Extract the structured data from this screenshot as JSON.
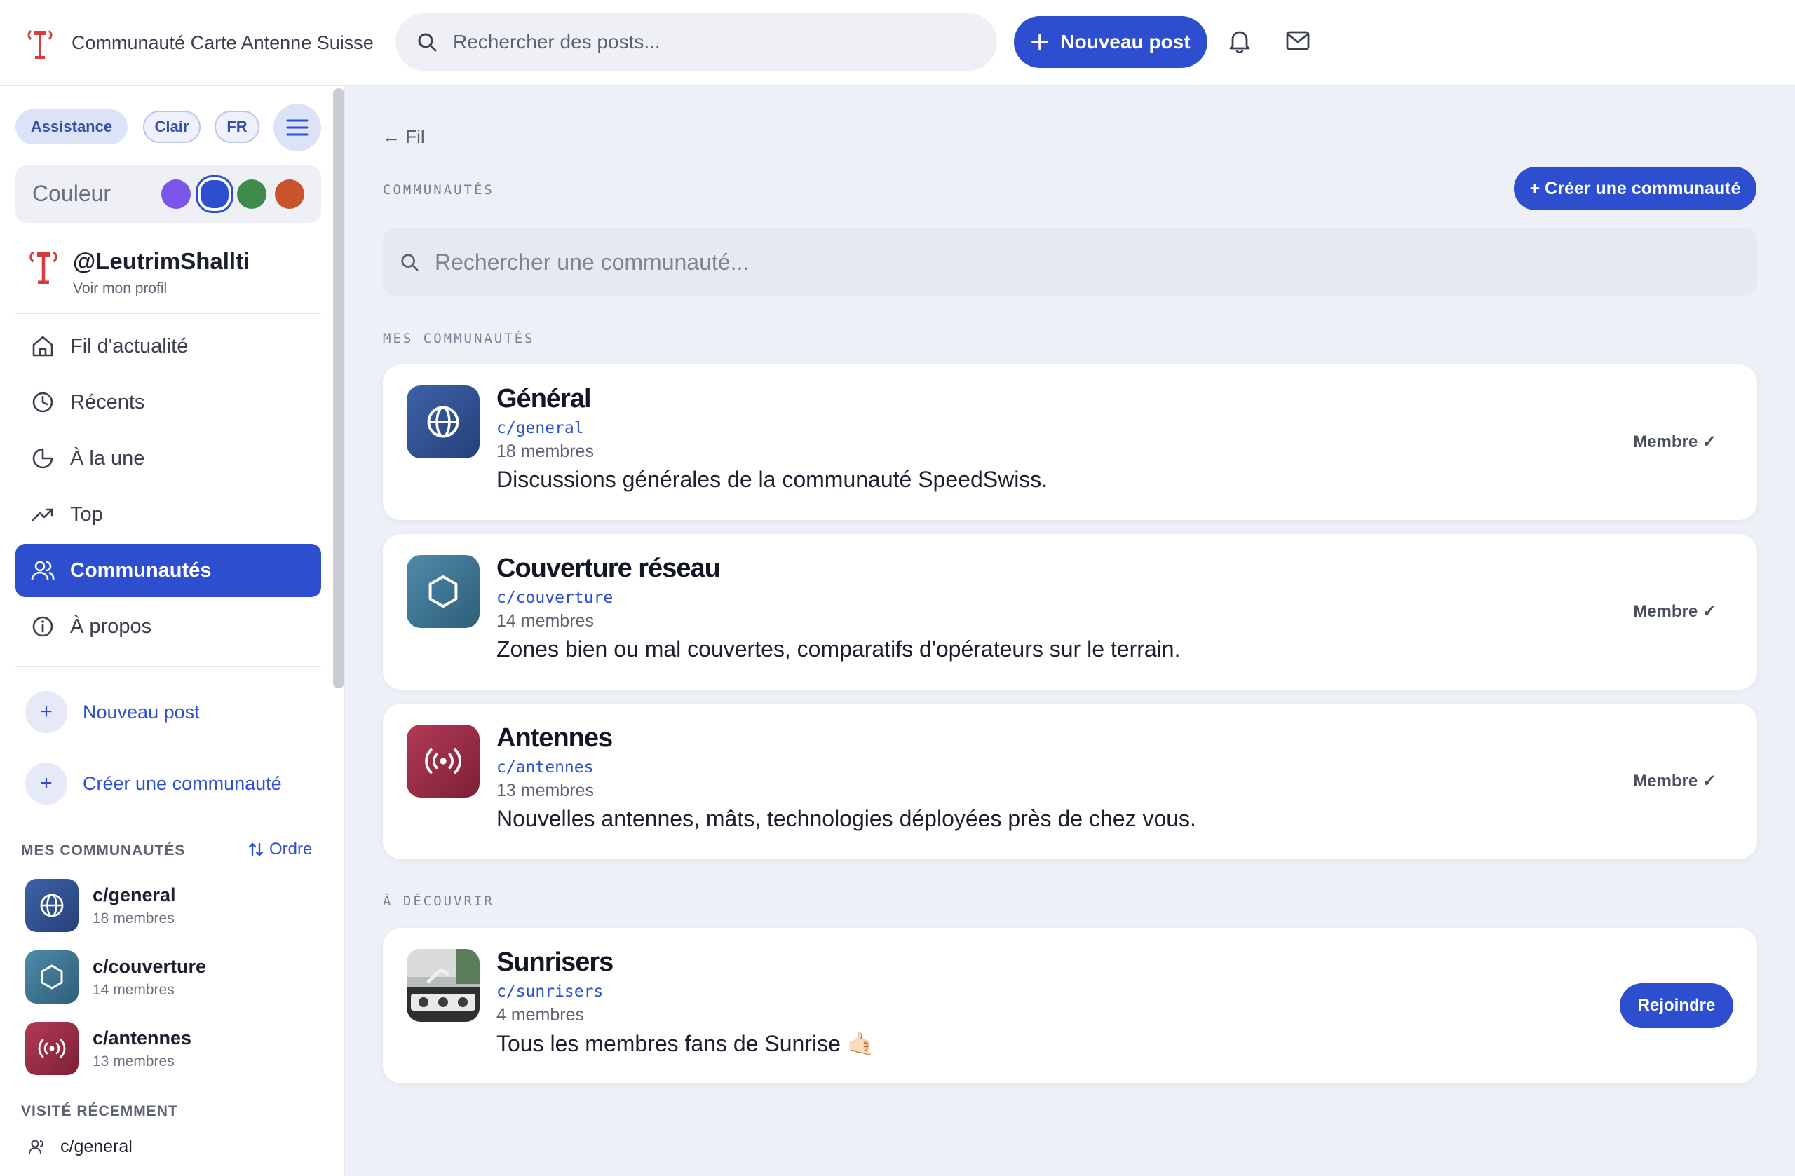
{
  "header": {
    "app_title": "Communauté Carte Antenne Suisse",
    "search_placeholder": "Rechercher des posts...",
    "new_post_label": "Nouveau post"
  },
  "sidebar": {
    "pills": {
      "assistance": "Assistance",
      "theme": "Clair",
      "lang": "FR"
    },
    "color_label": "Couleur",
    "colors": [
      "#7a57e8",
      "#2d4fcf",
      "#3e8a4a",
      "#c9532a"
    ],
    "profile": {
      "handle": "@LeutrimShallti",
      "sub": "Voir mon profil"
    },
    "nav": [
      {
        "label": "Fil d'actualité",
        "icon": "home-icon"
      },
      {
        "label": "Récents",
        "icon": "clock-icon"
      },
      {
        "label": "À la une",
        "icon": "pie-icon"
      },
      {
        "label": "Top",
        "icon": "trending-icon"
      },
      {
        "label": "Communautés",
        "icon": "users-icon",
        "active": true
      },
      {
        "label": "À propos",
        "icon": "info-icon"
      }
    ],
    "actions": {
      "new_post": "Nouveau post",
      "create_community": "Créer une communauté"
    },
    "my_communities_label": "MES COMMUNAUTÉS",
    "order_label": "Ordre",
    "my_communities": [
      {
        "name": "c/general",
        "members": "18 membres"
      },
      {
        "name": "c/couverture",
        "members": "14 membres"
      },
      {
        "name": "c/antennes",
        "members": "13 membres"
      }
    ],
    "recent_label": "VISITÉ RÉCEMMENT",
    "recent": [
      "c/general"
    ]
  },
  "main": {
    "back_label": "← Fil",
    "section_label": "COMMUNAUTÉS",
    "create_label": "+ Créer une communauté",
    "search_placeholder": "Rechercher une communauté...",
    "mine_label": "MES COMMUNAUTÉS",
    "discover_label": "À DÉCOUVRIR",
    "member_tag": "Membre ✓",
    "join_label": "Rejoindre",
    "mine": [
      {
        "title": "Général",
        "slug": "c/general",
        "members": "18 membres",
        "desc": "Discussions générales de la communauté SpeedSwiss."
      },
      {
        "title": "Couverture réseau",
        "slug": "c/couverture",
        "members": "14 membres",
        "desc": "Zones bien ou mal couvertes, comparatifs d'opérateurs sur le terrain."
      },
      {
        "title": "Antennes",
        "slug": "c/antennes",
        "members": "13 membres",
        "desc": "Nouvelles antennes, mâts, technologies déployées près de chez vous."
      }
    ],
    "discover": [
      {
        "title": "Sunrisers",
        "slug": "c/sunrisers",
        "members": "4 membres",
        "desc": "Tous les membres fans de Sunrise 🤙🏻"
      }
    ]
  }
}
